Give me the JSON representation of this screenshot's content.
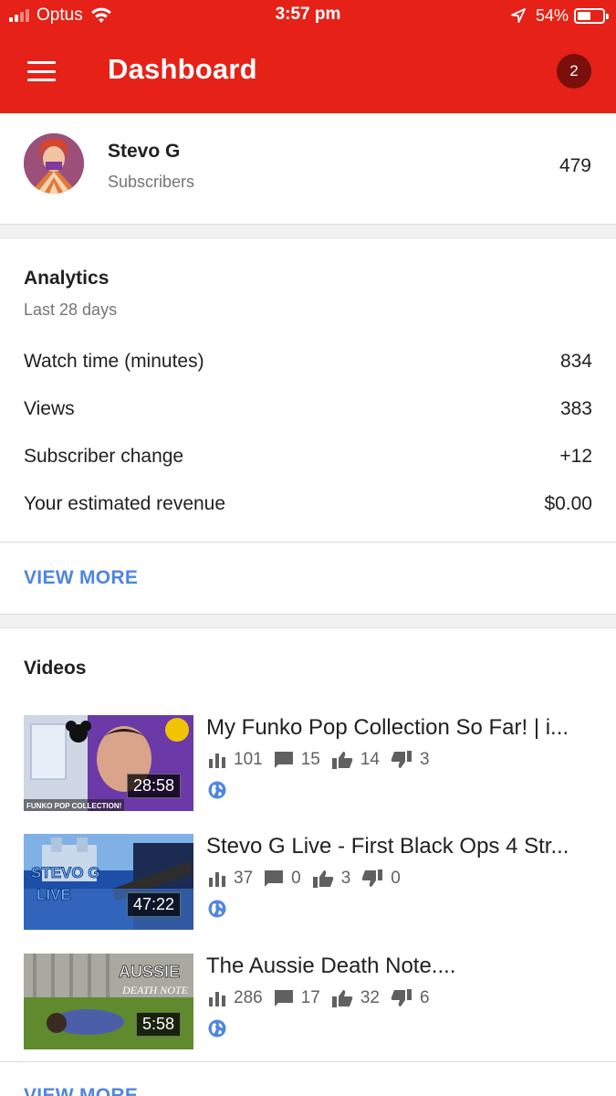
{
  "status_bar": {
    "carrier": "Optus",
    "time": "3:57 pm",
    "battery_percent": "54%",
    "battery_level": 0.54
  },
  "app_bar": {
    "menu_icon": "hamburger-menu-icon",
    "title": "Dashboard",
    "notification_count": "2"
  },
  "channel": {
    "name": "Stevo G",
    "subscribers_label": "Subscribers",
    "subscriber_count": "479"
  },
  "analytics": {
    "title": "Analytics",
    "period": "Last 28 days",
    "metrics": [
      {
        "label": "Watch time (minutes)",
        "value": "834"
      },
      {
        "label": "Views",
        "value": "383"
      },
      {
        "label": "Subscriber change",
        "value": "+12"
      },
      {
        "label": "Your estimated revenue",
        "value": "$0.00"
      }
    ],
    "view_more": "VIEW MORE"
  },
  "videos": {
    "title": "Videos",
    "items": [
      {
        "title": "My Funko Pop Collection So Far! | i...",
        "duration": "28:58",
        "views": "101",
        "comments": "15",
        "likes": "14",
        "dislikes": "3",
        "thumb_caption": "FUNKO POP COLLECTION!"
      },
      {
        "title": "Stevo G Live - First Black Ops 4 Str...",
        "duration": "47:22",
        "views": "37",
        "comments": "0",
        "likes": "3",
        "dislikes": "0",
        "thumb_caption": "STEVO G LIVE"
      },
      {
        "title": "The Aussie Death Note....",
        "duration": "5:58",
        "views": "286",
        "comments": "17",
        "likes": "32",
        "dislikes": "6",
        "thumb_caption": "AUSSIE DEATH NOTE"
      }
    ],
    "view_more": "VIEW MORE"
  },
  "colors": {
    "brand_red": "#e62117",
    "link_blue": "#4f86e0",
    "badge": "#7a0f0b"
  }
}
